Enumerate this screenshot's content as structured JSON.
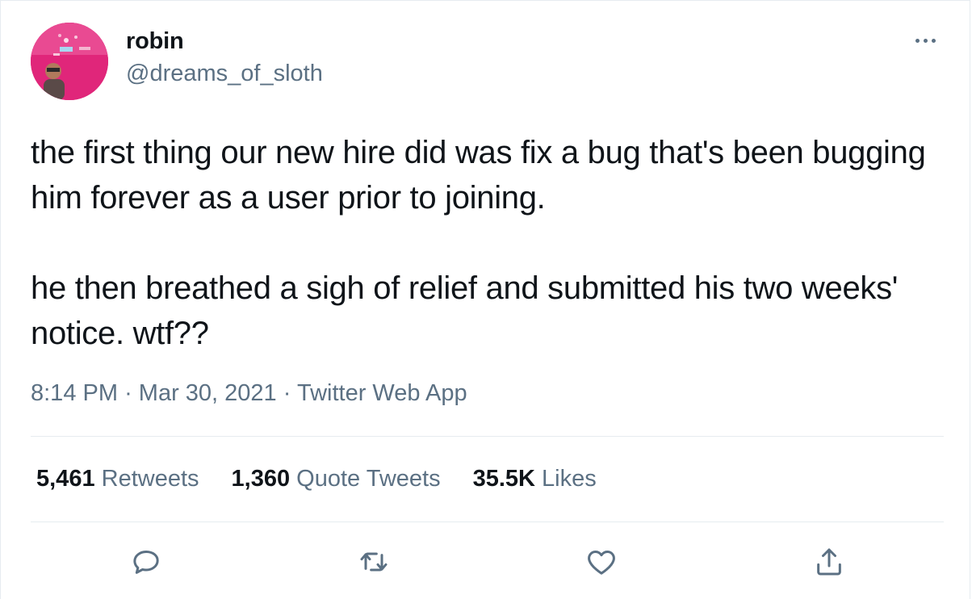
{
  "author": {
    "display_name": "robin",
    "handle": "@dreams_of_sloth"
  },
  "tweet": {
    "paragraphs": [
      "the first thing our new hire did was fix a bug that's been bugging him forever as a user prior to joining.",
      "he then breathed a sigh of relief and submitted his two weeks' notice. wtf??"
    ],
    "time": "8:14 PM",
    "separator": "·",
    "date": "Mar 30, 2021",
    "source": "Twitter Web App"
  },
  "stats": {
    "retweets_count": "5,461",
    "retweets_label": "Retweets",
    "quotes_count": "1,360",
    "quotes_label": "Quote Tweets",
    "likes_count": "35.5K",
    "likes_label": "Likes"
  },
  "icons": {
    "more": "more-horizontal-icon",
    "reply": "reply-icon",
    "retweet": "retweet-icon",
    "like": "heart-icon",
    "share": "share-icon"
  },
  "colors": {
    "text": "#0f1419",
    "secondary": "#5b7083",
    "divider": "#e6ecf0",
    "avatar_bg": "#e0267a"
  }
}
